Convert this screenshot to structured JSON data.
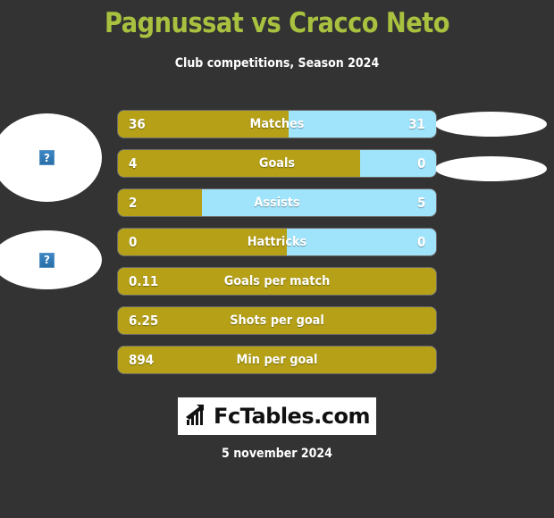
{
  "header": {
    "title": "Pagnussat vs Cracco Neto",
    "subtitle": "Club competitions, Season 2024",
    "title_color": "#a8c13f",
    "subtitle_color": "#ffffff"
  },
  "theme": {
    "background": "#333333",
    "home_color": "#b5a017",
    "away_color": "#a0e4fb"
  },
  "avatars": {
    "placeholder_glyph": "?",
    "left": [
      {
        "name": "home-player-photo"
      },
      {
        "name": "home-club-logo"
      }
    ],
    "right": [
      {
        "name": "away-player-photo"
      },
      {
        "name": "away-club-logo"
      }
    ]
  },
  "chart_data": {
    "type": "bar",
    "title": "Pagnussat vs Cracco Neto",
    "subtitle": "Club competitions, Season 2024",
    "orientation": "horizontal-diverging",
    "series": [
      {
        "name": "Pagnussat",
        "color": "#b5a017"
      },
      {
        "name": "Cracco Neto",
        "color": "#a0e4fb"
      }
    ],
    "categories": [
      "Matches",
      "Goals",
      "Assists",
      "Hattricks",
      "Goals per match",
      "Shots per goal",
      "Min per goal"
    ],
    "rows": [
      {
        "label": "Matches",
        "left_value": "36",
        "right_value": "31",
        "left_pct": 53.7,
        "has_right": true
      },
      {
        "label": "Goals",
        "left_value": "4",
        "right_value": "0",
        "left_pct": 76.0,
        "has_right": true
      },
      {
        "label": "Assists",
        "left_value": "2",
        "right_value": "5",
        "left_pct": 26.5,
        "has_right": true
      },
      {
        "label": "Hattricks",
        "left_value": "0",
        "right_value": "0",
        "left_pct": 53.0,
        "has_right": true
      },
      {
        "label": "Goals per match",
        "left_value": "0.11",
        "right_value": "",
        "left_pct": 100,
        "has_right": false
      },
      {
        "label": "Shots per goal",
        "left_value": "6.25",
        "right_value": "",
        "left_pct": 100,
        "has_right": false
      },
      {
        "label": "Min per goal",
        "left_value": "894",
        "right_value": "",
        "left_pct": 100,
        "has_right": false
      }
    ]
  },
  "footer": {
    "logo_text": "FcTables.com",
    "logo_icon": "bar-chart-arrow-icon",
    "date": "5 november 2024"
  }
}
